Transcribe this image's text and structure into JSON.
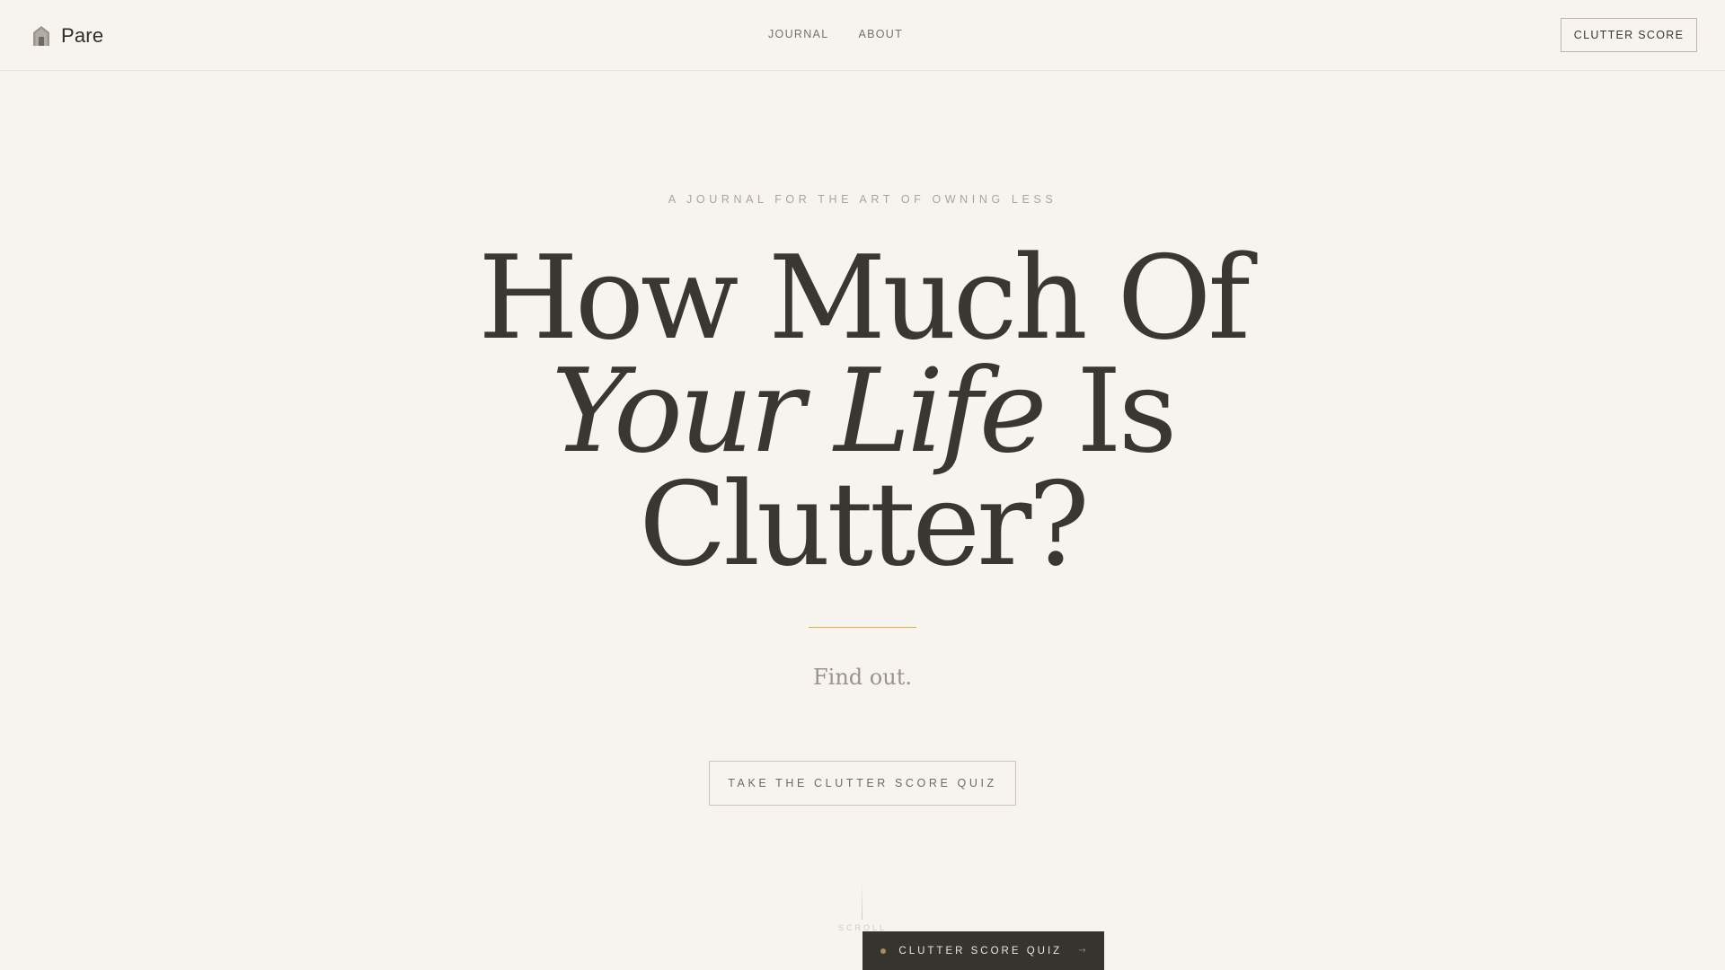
{
  "header": {
    "brand_name": "Pare",
    "brand_icon": "house-icon",
    "nav": [
      {
        "label": "JOURNAL"
      },
      {
        "label": "ABOUT"
      }
    ],
    "cta_label": "CLUTTER SCORE"
  },
  "hero": {
    "eyebrow": "A JOURNAL FOR THE ART OF OWNING LESS",
    "headline": {
      "line1": "How Much Of",
      "line2_italic": "Your Life",
      "line2_rest": " Is",
      "line3": "Clutter?"
    },
    "tagline": "Find out.",
    "cta_label": "TAKE THE CLUTTER SCORE QUIZ"
  },
  "scroll": {
    "label": "SCROLL"
  },
  "quiz_tab": {
    "label": "CLUTTER SCORE QUIZ",
    "arrow": "→",
    "icon": "dot-icon"
  },
  "colors": {
    "background": "#f7f4ef",
    "text": "#3a3632",
    "accent_gold": "#c9b27c",
    "dark_tab": "#37332f"
  }
}
